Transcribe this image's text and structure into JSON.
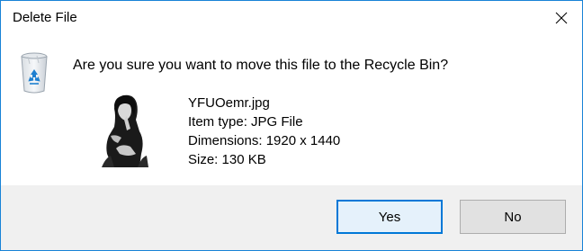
{
  "dialog": {
    "title": "Delete File",
    "question": "Are you sure you want to move this file to the Recycle Bin?"
  },
  "file": {
    "name": "YFUOemr.jpg",
    "type_line": "Item type: JPG File",
    "dimensions_line": "Dimensions: 1920 x 1440",
    "size_line": "Size: 130 KB",
    "thumbnail": "photo-thumbnail"
  },
  "buttons": {
    "yes": "Yes",
    "no": "No"
  },
  "icons": {
    "close": "close-icon",
    "recycle": "recycle-bin-icon"
  },
  "colors": {
    "accent": "#0078d7",
    "window_border": "#1883d7",
    "footer_bg": "#f0f0f0"
  }
}
